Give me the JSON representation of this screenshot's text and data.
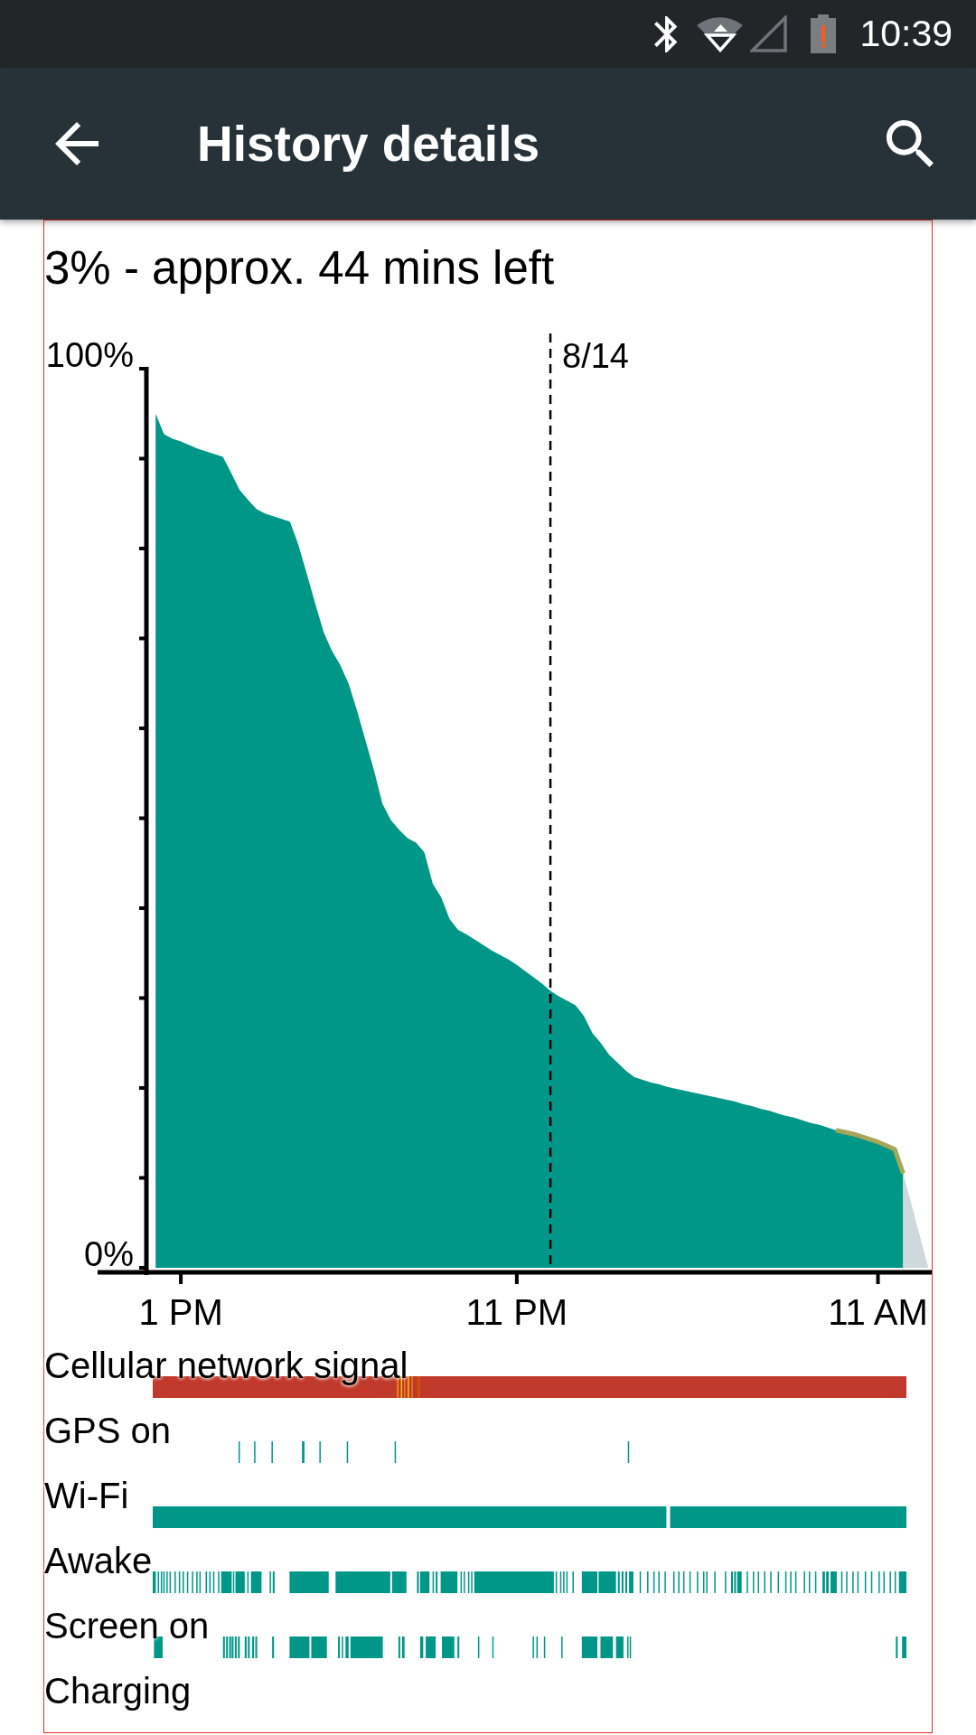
{
  "status_bar": {
    "time": "10:39"
  },
  "app_bar": {
    "title": "History details"
  },
  "battery": {
    "status": "3% - approx. 44 mins left",
    "chart_data": {
      "type": "area",
      "categories": [
        null,
        null,
        null,
        null,
        "1 PM",
        null,
        null,
        null,
        null,
        null,
        null,
        null,
        null,
        null,
        null,
        null,
        null,
        null,
        null,
        null,
        null,
        null,
        null,
        null,
        null,
        null,
        null,
        null,
        null,
        null,
        null,
        null,
        null,
        null,
        null,
        null,
        null,
        null,
        null,
        null,
        null,
        null,
        null,
        null,
        "11 PM",
        null,
        null,
        null,
        null,
        null,
        null,
        null,
        null,
        null,
        null,
        null,
        null,
        null,
        null,
        null,
        null,
        null,
        null,
        null,
        null,
        null,
        null,
        null,
        null,
        null,
        null,
        null,
        null,
        null,
        null,
        null,
        null,
        null,
        null,
        null,
        null,
        null,
        null,
        null,
        null,
        null,
        null,
        "11 AM",
        null,
        null,
        null,
        null,
        null,
        null
      ],
      "series": [
        {
          "color": "#009688",
          "values": [
            null,
            95.0,
            92.7,
            92.2,
            91.9,
            91.5,
            91.1,
            90.8,
            90.5,
            90.2,
            88.4,
            86.5,
            85.4,
            84.4,
            83.9,
            83.6,
            83.3,
            83.0,
            80.4,
            77.2,
            73.9,
            70.7,
            68.6,
            67.0,
            64.9,
            61.9,
            58.6,
            55.3,
            51.6,
            49.8,
            48.7,
            47.8,
            47.3,
            46.2,
            42.7,
            41.2,
            38.8,
            37.6,
            37.1,
            36.5,
            35.9,
            35.3,
            34.8,
            34.3,
            33.7,
            33.0,
            32.3,
            31.6,
            30.8,
            30.2,
            29.7,
            29.2,
            28.0,
            26.1,
            25.0,
            23.7,
            22.8,
            21.9,
            21.2,
            20.9,
            20.6,
            20.4,
            20.1,
            19.9,
            19.7,
            19.5,
            19.3,
            19.1,
            18.9,
            18.7,
            18.5,
            18.2,
            18.0,
            17.7,
            17.5,
            17.2,
            16.9,
            16.7,
            16.4,
            16.1,
            15.9,
            15.6,
            15.3,
            15.1,
            14.9,
            14.6,
            14.3,
            14.0,
            13.6,
            13.2,
            10.5,
            null,
            null,
            null
          ]
        },
        {
          "color": "#cfd8dc",
          "values": [
            null,
            null,
            null,
            null,
            null,
            null,
            null,
            null,
            null,
            null,
            null,
            null,
            null,
            null,
            null,
            null,
            null,
            null,
            null,
            null,
            null,
            null,
            null,
            null,
            null,
            null,
            null,
            null,
            null,
            null,
            null,
            null,
            null,
            null,
            null,
            null,
            null,
            null,
            null,
            null,
            null,
            null,
            null,
            null,
            null,
            null,
            null,
            null,
            null,
            null,
            null,
            null,
            null,
            null,
            null,
            null,
            null,
            null,
            null,
            null,
            null,
            null,
            null,
            null,
            null,
            null,
            null,
            null,
            null,
            null,
            null,
            null,
            null,
            null,
            null,
            null,
            null,
            null,
            null,
            null,
            null,
            null,
            null,
            null,
            null,
            null,
            null,
            null,
            null,
            null,
            10.5,
            7.0,
            3.5,
            0
          ]
        },
        {
          "type": "line",
          "color": "#a9a65a",
          "values": [
            null,
            null,
            null,
            null,
            null,
            null,
            null,
            null,
            null,
            null,
            null,
            null,
            null,
            null,
            null,
            null,
            null,
            null,
            null,
            null,
            null,
            null,
            null,
            null,
            null,
            null,
            null,
            null,
            null,
            null,
            null,
            null,
            null,
            null,
            null,
            null,
            null,
            null,
            null,
            null,
            null,
            null,
            null,
            null,
            null,
            null,
            null,
            null,
            null,
            null,
            null,
            null,
            null,
            null,
            null,
            null,
            null,
            null,
            null,
            null,
            null,
            null,
            null,
            null,
            null,
            null,
            null,
            null,
            null,
            null,
            null,
            null,
            null,
            null,
            null,
            null,
            null,
            null,
            null,
            null,
            null,
            null,
            15.3,
            15.1,
            14.9,
            14.6,
            14.3,
            14.0,
            13.6,
            13.2,
            10.5,
            null,
            null,
            null
          ]
        }
      ],
      "ylim": [
        0,
        100
      ],
      "yticks": [
        {
          "value": 0,
          "label": "0%"
        },
        {
          "value": 100,
          "label": "100%"
        }
      ]
    },
    "date_marker": {
      "label": "8/14"
    }
  },
  "timelines": [
    {
      "label": "Cellular network signal",
      "kind": "signal"
    },
    {
      "label": "GPS on",
      "kind": "gps"
    },
    {
      "label": "Wi-Fi",
      "kind": "wifi"
    },
    {
      "label": "Awake",
      "kind": "awake"
    },
    {
      "label": "Screen on",
      "kind": "screen"
    },
    {
      "label": "Charging",
      "kind": "charging"
    }
  ]
}
